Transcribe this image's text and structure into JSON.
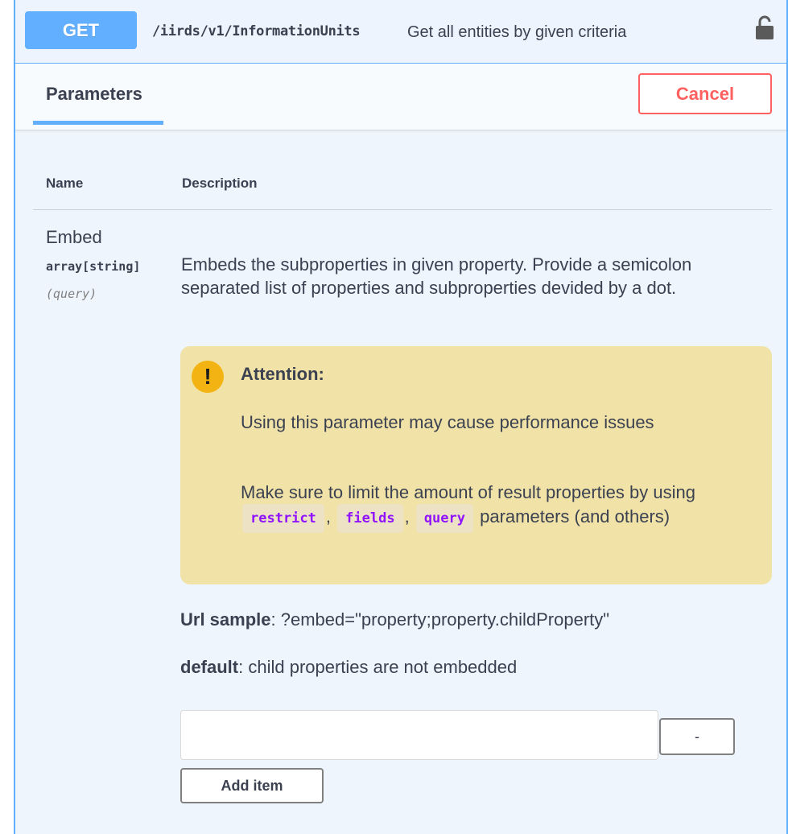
{
  "operation": {
    "method": "GET",
    "path": "/iirds/v1/InformationUnits",
    "summary": "Get all entities by given criteria",
    "lock_icon": "lock-icon",
    "method_color": "#61affe"
  },
  "tabs": {
    "parameters_label": "Parameters",
    "cancel_label": "Cancel"
  },
  "table": {
    "headers": {
      "name": "Name",
      "description": "Description"
    }
  },
  "parameter": {
    "name": "Embed",
    "type": "array[string]",
    "in": "(query)",
    "description": "Embeds the subproperties in given property. Provide a semicolon separated list of properties and subproperties devided by a dot.",
    "attention": {
      "icon": "exclamation-icon",
      "title": "Attention:",
      "p1": "Using this parameter may cause performance issues",
      "p2_prefix": "Make sure to limit the amount of result properties by using",
      "codes": [
        "restrict",
        "fields",
        "query"
      ],
      "sep1": ",",
      "sep2": ",",
      "p2_suffix": "parameters (and others)"
    },
    "url_sample_label": "Url sample",
    "url_sample_value": ": ?embed=\"property;property.childProperty\"",
    "default_label": "default",
    "default_value": ": child properties are not embedded",
    "input_value": "",
    "remove_label": "-",
    "add_item_label": "Add item"
  }
}
